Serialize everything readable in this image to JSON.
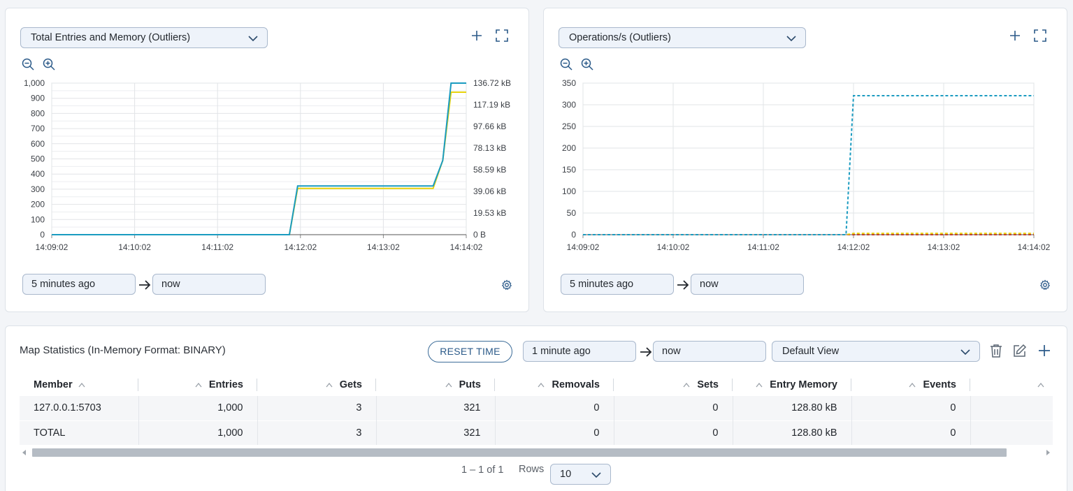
{
  "colors": {
    "accent": "#2b5a89",
    "series_teal": "#1a9bc0",
    "series_yellow": "#e8d30c",
    "series_red": "#c0392b"
  },
  "left_panel": {
    "metric_select": "Total Entries and Memory (Outliers)",
    "time_from": "5 minutes ago",
    "time_to": "now"
  },
  "right_panel": {
    "metric_select": "Operations/s (Outliers)",
    "time_from": "5 minutes ago",
    "time_to": "now"
  },
  "chart_data": [
    {
      "type": "line",
      "x_ticks": [
        "14:09:02",
        "14:10:02",
        "14:11:02",
        "14:12:02",
        "14:13:02",
        "14:14:02"
      ],
      "y_ticks_left": [
        "1,000",
        "900",
        "800",
        "700",
        "600",
        "500",
        "400",
        "300",
        "200",
        "100",
        "0"
      ],
      "y_ticks_right": [
        "136.72 kB",
        "117.19 kB",
        "97.66 kB",
        "78.13 kB",
        "58.59 kB",
        "39.06 kB",
        "19.53 kB",
        "0 B"
      ],
      "ylim": [
        0,
        1000
      ],
      "grid": true,
      "series": [
        {
          "color": "#e8d30c",
          "x": [
            "14:09:02",
            "14:11:54",
            "14:12:00",
            "14:13:38",
            "14:13:45",
            "14:13:51",
            "14:14:02"
          ],
          "values": [
            0,
            0,
            305,
            305,
            490,
            940,
            940
          ]
        },
        {
          "color": "#1a9bc0",
          "x": [
            "14:09:02",
            "14:11:54",
            "14:12:00",
            "14:13:38",
            "14:13:45",
            "14:13:51",
            "14:14:02"
          ],
          "values": [
            0,
            0,
            321,
            321,
            490,
            1000,
            1000
          ]
        }
      ]
    },
    {
      "type": "line",
      "x_ticks": [
        "14:09:02",
        "14:10:02",
        "14:11:02",
        "14:12:02",
        "14:13:02",
        "14:14:02"
      ],
      "y_ticks": [
        "350",
        "300",
        "250",
        "200",
        "150",
        "100",
        "50",
        "0"
      ],
      "ylim": [
        0,
        350
      ],
      "grid": true,
      "series": [
        {
          "color": "#c0392b",
          "x": [
            "14:09:02",
            "14:14:02"
          ],
          "values": [
            0,
            0
          ]
        },
        {
          "color": "#e8d30c",
          "x": [
            "14:09:02",
            "14:11:57",
            "14:12:02",
            "14:14:02"
          ],
          "values": [
            0,
            0,
            3,
            3
          ]
        },
        {
          "color": "#1a9bc0",
          "x": [
            "14:09:02",
            "14:11:57",
            "14:12:02",
            "14:14:02"
          ],
          "values": [
            0,
            0,
            321,
            321
          ]
        }
      ]
    }
  ],
  "stats": {
    "title": "Map Statistics (In-Memory Format: BINARY)",
    "reset_label": "RESET TIME",
    "time_from": "1 minute ago",
    "time_to": "now",
    "view_select": "Default View",
    "columns": [
      "Member",
      "Entries",
      "Gets",
      "Puts",
      "Removals",
      "Sets",
      "Entry Memory",
      "Events"
    ],
    "rows": [
      [
        "127.0.0.1:5703",
        "1,000",
        "3",
        "321",
        "0",
        "0",
        "128.80 kB",
        "0"
      ],
      [
        "TOTAL",
        "1,000",
        "3",
        "321",
        "0",
        "0",
        "128.80 kB",
        "0"
      ]
    ],
    "pagination": "1 – 1 of 1",
    "rows_label": "Rows",
    "rows_value": "10"
  }
}
